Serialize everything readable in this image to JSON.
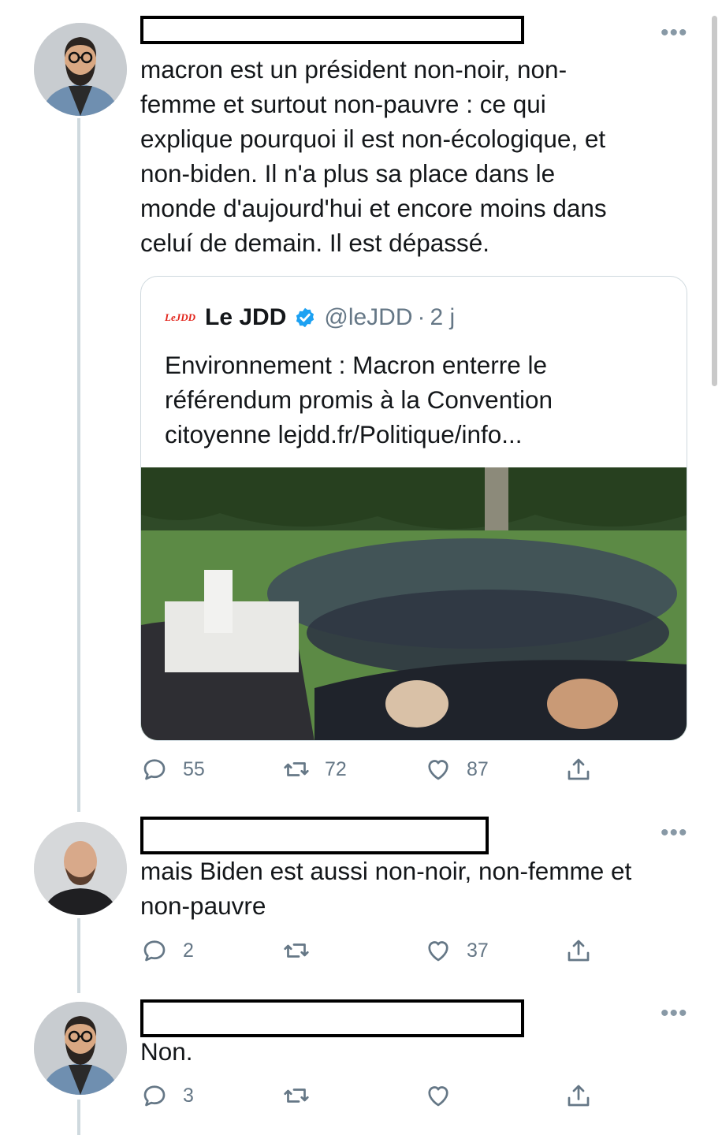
{
  "tweets": [
    {
      "text": "macron est un président non-noir, non-\nfemme et surtout non-pauvre : ce qui\nexplique pourquoi il est non-écologique, et\nnon-biden. Il n'a plus sa place dans le\nmonde d'aujourd'hui et encore moins dans\nceluí de demain. Il est dépassé.",
      "more_label": "•••",
      "replies": "55",
      "retweets": "72",
      "likes": "87"
    },
    {
      "text": "mais Biden est aussi non-noir, non-femme et\nnon-pauvre",
      "more_label": "•••",
      "replies": "2",
      "retweets": "",
      "likes": "37"
    },
    {
      "text": "Non.",
      "more_label": "•••",
      "replies": "3",
      "retweets": "",
      "likes": ""
    }
  ],
  "quoted": {
    "logo_text": "LeJDD",
    "name": "Le JDD",
    "handle": "@leJDD",
    "separator": "·",
    "time": "2 j",
    "text": "Environnement : Macron enterre le\nréférendum promis à la Convention\ncitoyenne lejdd.fr/Politique/info..."
  },
  "icons": {
    "reply": "reply-icon",
    "retweet": "retweet-icon",
    "like": "heart-icon",
    "share": "share-icon",
    "verified": "verified-badge-icon"
  },
  "colors": {
    "text": "#14171a",
    "secondary": "#657786",
    "verified": "#1da1f2",
    "jdd_red": "#e2231a",
    "divider": "#cfd9de"
  }
}
